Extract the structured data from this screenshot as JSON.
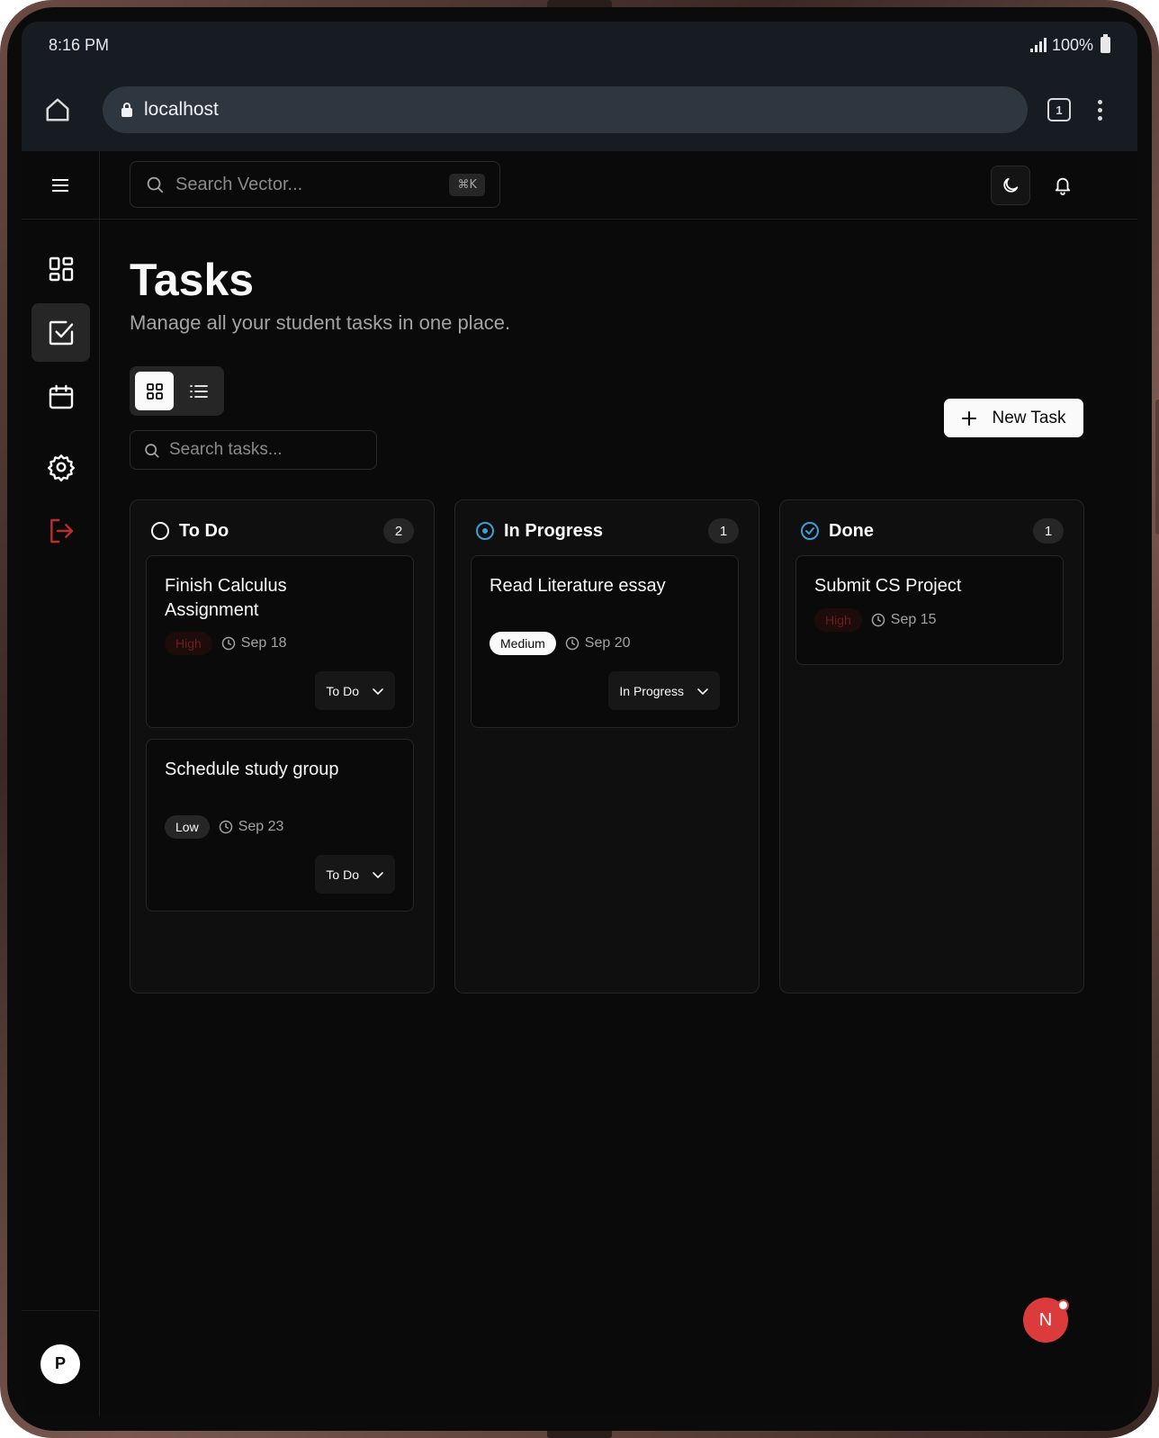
{
  "status_bar": {
    "time": "8:16 PM",
    "battery": "100%"
  },
  "browser": {
    "url": "localhost",
    "tab_count": "1"
  },
  "topbar": {
    "search_placeholder": "Search Vector...",
    "shortcut": "⌘K"
  },
  "page": {
    "title": "Tasks",
    "subtitle": "Manage all your student tasks in one place.",
    "search_placeholder": "Search tasks...",
    "new_task_label": "New Task"
  },
  "user": {
    "avatar_initial": "P"
  },
  "fab": {
    "initial": "N"
  },
  "columns": [
    {
      "title": "To Do",
      "count": "2",
      "cards": [
        {
          "title": "Finish Calculus Assignment",
          "priority": "High",
          "due": "Sep 18",
          "status": "To Do"
        },
        {
          "title": "Schedule study group",
          "priority": "Low",
          "due": "Sep 23",
          "status": "To Do"
        }
      ]
    },
    {
      "title": "In Progress",
      "count": "1",
      "cards": [
        {
          "title": "Read Literature essay",
          "priority": "Medium",
          "due": "Sep 20",
          "status": "In Progress"
        }
      ]
    },
    {
      "title": "Done",
      "count": "1",
      "cards": [
        {
          "title": "Submit CS Project",
          "priority": "High",
          "due": "Sep 15"
        }
      ]
    }
  ],
  "colors": {
    "background": "#0a0a0a",
    "in_progress_accent": "#3aa0d8",
    "logout_accent": "#b92e2e",
    "high_priority": "#6b1f1f",
    "fab": "#dc3b3b"
  }
}
